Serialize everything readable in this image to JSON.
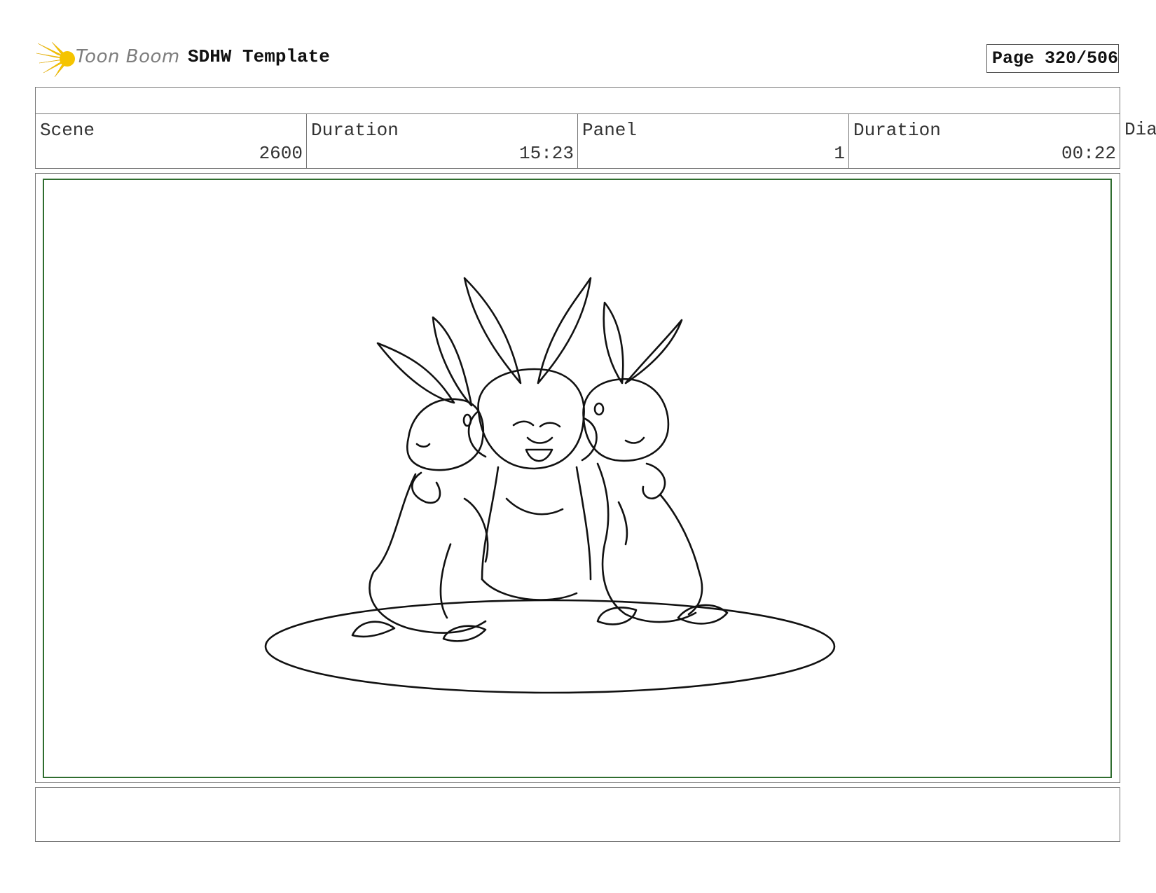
{
  "header": {
    "logo_text": "Toon Boom",
    "title": "SDHW Template",
    "page": "Page 320/506"
  },
  "fields": [
    {
      "label": "Scene",
      "value": "2600"
    },
    {
      "label": "Duration",
      "value": "15:23"
    },
    {
      "label": "Panel",
      "value": "1"
    },
    {
      "label": "Duration",
      "value": "00:22"
    },
    {
      "label": "Dia",
      "value": ""
    }
  ],
  "colors": {
    "logo_accent": "#f5c400",
    "panel_border": "#2f6d2f"
  }
}
